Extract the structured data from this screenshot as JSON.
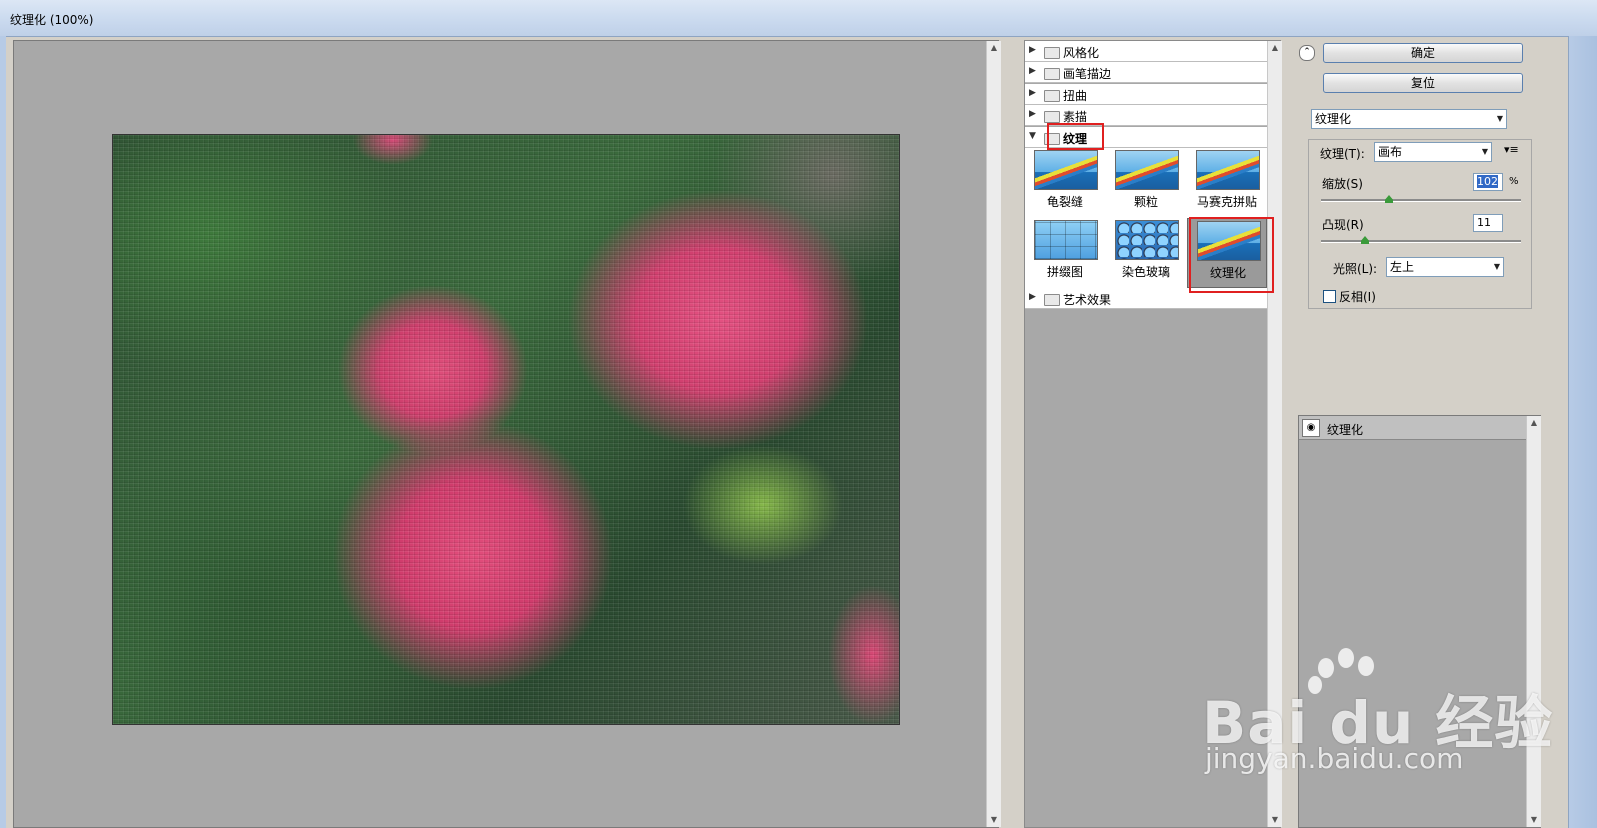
{
  "window": {
    "title": "纹理化 (100%)"
  },
  "gallery": {
    "categories": [
      {
        "label": "风格化",
        "open": false
      },
      {
        "label": "画笔描边",
        "open": false
      },
      {
        "label": "扭曲",
        "open": false
      },
      {
        "label": "素描",
        "open": false
      },
      {
        "label": "纹理",
        "open": true
      },
      {
        "label": "艺术效果",
        "open": false
      }
    ],
    "texture_filters": [
      {
        "label": "龟裂缝"
      },
      {
        "label": "颗粒"
      },
      {
        "label": "马赛克拼贴"
      },
      {
        "label": "拼缀图"
      },
      {
        "label": "染色玻璃"
      },
      {
        "label": "纹理化",
        "selected": true
      }
    ]
  },
  "panel": {
    "ok_label": "确定",
    "reset_label": "复位",
    "filter_select": "纹理化",
    "texture_label": "纹理(T):",
    "texture_value": "画布",
    "scale_label": "缩放(S)",
    "scale_value": "102",
    "scale_unit": "%",
    "scale_fraction": 0.34,
    "relief_label": "凸现(R)",
    "relief_value": "11",
    "relief_fraction": 0.22,
    "light_label": "光照(L):",
    "light_value": "左上",
    "invert_label": "反相(I)",
    "invert_checked": false
  },
  "layers": [
    {
      "label": "纹理化"
    }
  ],
  "watermark": {
    "brand": "Bai du 经验",
    "url": "jingyan.baidu.com"
  },
  "colors": {
    "highlight": "#e02020",
    "canvas_bg": "#a8a8a8"
  }
}
